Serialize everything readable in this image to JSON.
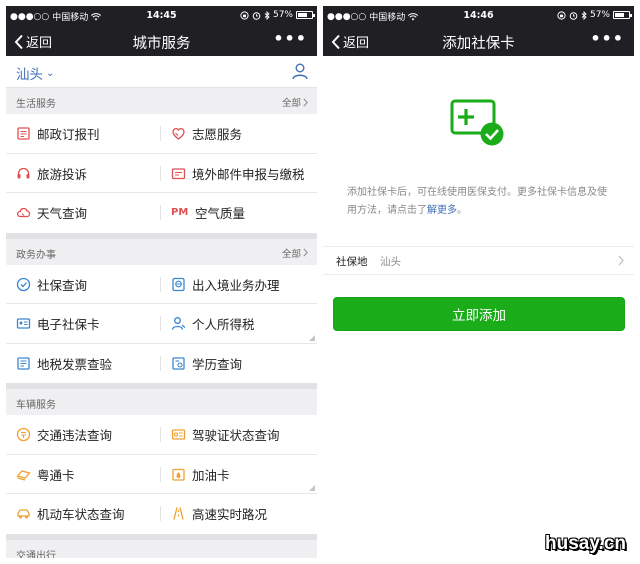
{
  "status_left": {
    "signal": "●●●○○",
    "carrier": "中国移动",
    "wifi_icon": "wifi-icon"
  },
  "status_right_pct": "57%",
  "status_battery_level": 0.57,
  "left_screen": {
    "time": "14:45",
    "back_label": "返回",
    "title": "城市服务",
    "more_label": "•••",
    "city": "汕头",
    "city_arrow": "⌄",
    "all_label": "全部",
    "sections": [
      {
        "title": "生活服务",
        "show_all": true,
        "rows": [
          [
            {
              "label": "邮政订报刊",
              "icon": "newspaper-icon"
            },
            {
              "label": "志愿服务",
              "icon": "heart-hand-icon"
            }
          ],
          [
            {
              "label": "旅游投诉",
              "icon": "headset-icon"
            },
            {
              "label": "境外邮件申报与缴税",
              "icon": "mail-tax-icon"
            }
          ],
          [
            {
              "label": "天气查询",
              "icon": "weather-icon"
            },
            {
              "label": "空气质量",
              "icon": "pm-icon",
              "glyph": "PM"
            }
          ]
        ]
      },
      {
        "title": "政务办事",
        "show_all": true,
        "rows": [
          [
            {
              "label": "社保查询",
              "icon": "social-security-icon"
            },
            {
              "label": "出入境业务办理",
              "icon": "passport-icon"
            }
          ],
          [
            {
              "label": "电子社保卡",
              "icon": "id-card-icon"
            },
            {
              "label": "个人所得税",
              "icon": "person-tax-icon"
            }
          ],
          [
            {
              "label": "地税发票查验",
              "icon": "invoice-icon"
            },
            {
              "label": "学历查询",
              "icon": "certificate-icon"
            }
          ]
        ]
      },
      {
        "title": "车辆服务",
        "show_all": false,
        "rows": [
          [
            {
              "label": "交通违法查询",
              "icon": "traffic-violation-icon"
            },
            {
              "label": "驾驶证状态查询",
              "icon": "license-icon"
            }
          ],
          [
            {
              "label": "粤通卡",
              "icon": "etc-card-icon"
            },
            {
              "label": "加油卡",
              "icon": "fuel-card-icon"
            }
          ],
          [
            {
              "label": "机动车状态查询",
              "icon": "car-icon"
            },
            {
              "label": "高速实时路况",
              "icon": "highway-icon"
            }
          ]
        ]
      },
      {
        "title": "交通出行",
        "show_all": false,
        "rows": []
      }
    ]
  },
  "right_screen": {
    "time": "14:46",
    "back_label": "返回",
    "title": "添加社保卡",
    "more_label": "•••",
    "description": "添加社保卡后，可在线使用医保支付。更多社保卡信息及使用方法，请点击了",
    "description_link": "解更多",
    "description_end": "。",
    "field_label": "社保地",
    "field_value": "汕头",
    "button_label": "立即添加"
  },
  "watermark": "husay.cn",
  "colors": {
    "accent_green": "#1aad19",
    "link_blue": "#3d6fb6",
    "nav_dark": "#1f1f24",
    "orange_icon": "#f0a030",
    "blue_icon": "#3a86d0",
    "red_icon": "#e05050"
  }
}
